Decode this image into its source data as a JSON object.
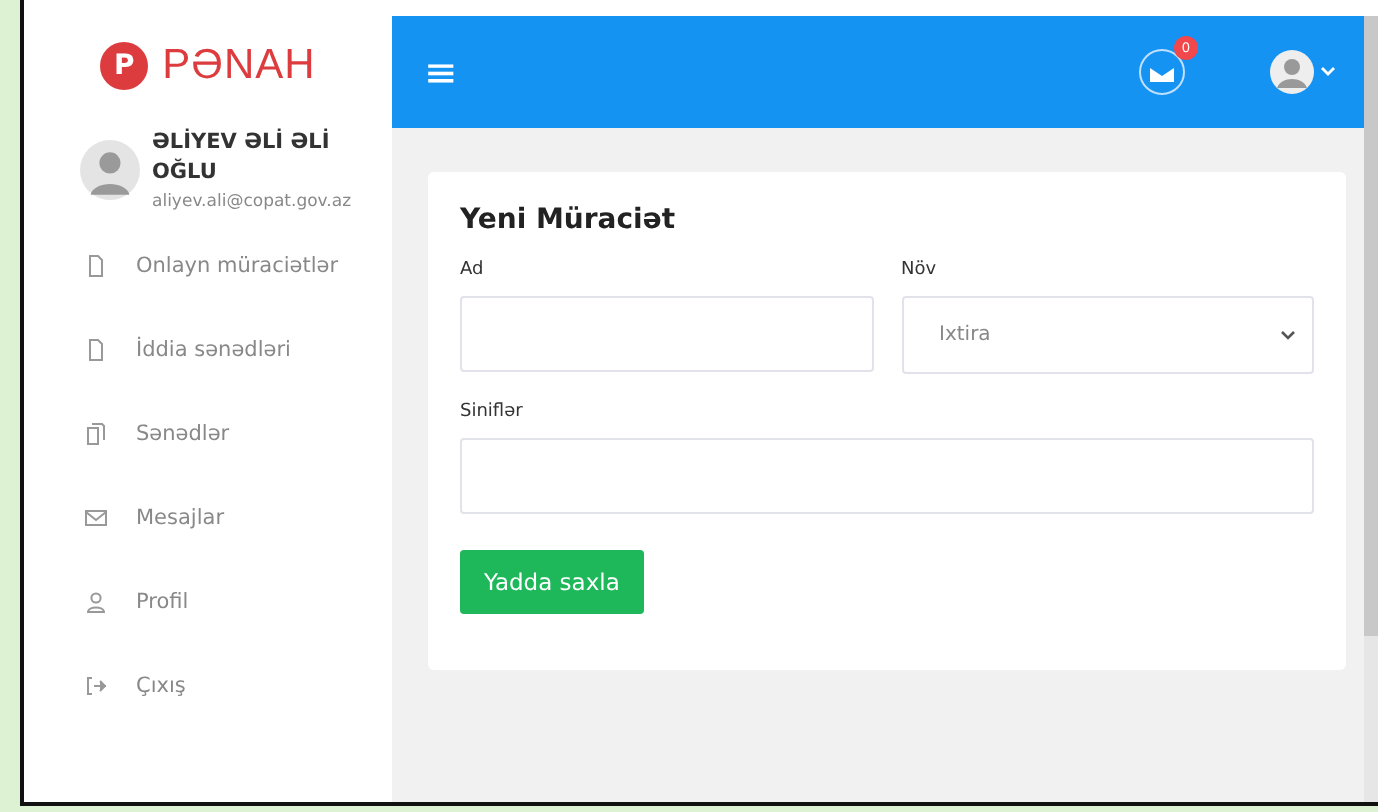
{
  "brand": {
    "logo_letter": "P",
    "name": "PƏNAH"
  },
  "user": {
    "name": "ƏLİYEV ƏLİ ƏLİ OĞLU",
    "email": "aliyev.ali@copat.gov.az"
  },
  "nav": [
    {
      "label": "Onlayn müraciətlər",
      "kind": "file"
    },
    {
      "label": "İddia sənədləri",
      "kind": "file"
    },
    {
      "label": "Sənədlər",
      "kind": "files"
    },
    {
      "label": "Mesajlar",
      "kind": "mail"
    },
    {
      "label": "Profil",
      "kind": "user"
    },
    {
      "label": "Çıxış",
      "kind": "logout"
    }
  ],
  "topbar": {
    "menu_glyph": "≡",
    "notification_count": "0"
  },
  "form": {
    "title": "Yeni Müraciət",
    "fields": [
      {
        "label": "Ad",
        "kind": "text"
      },
      {
        "label": "Növ",
        "kind": "select",
        "value": "Ixtira"
      },
      {
        "label": "Siniflər",
        "kind": "text"
      }
    ],
    "submit": "Yadda saxla"
  }
}
